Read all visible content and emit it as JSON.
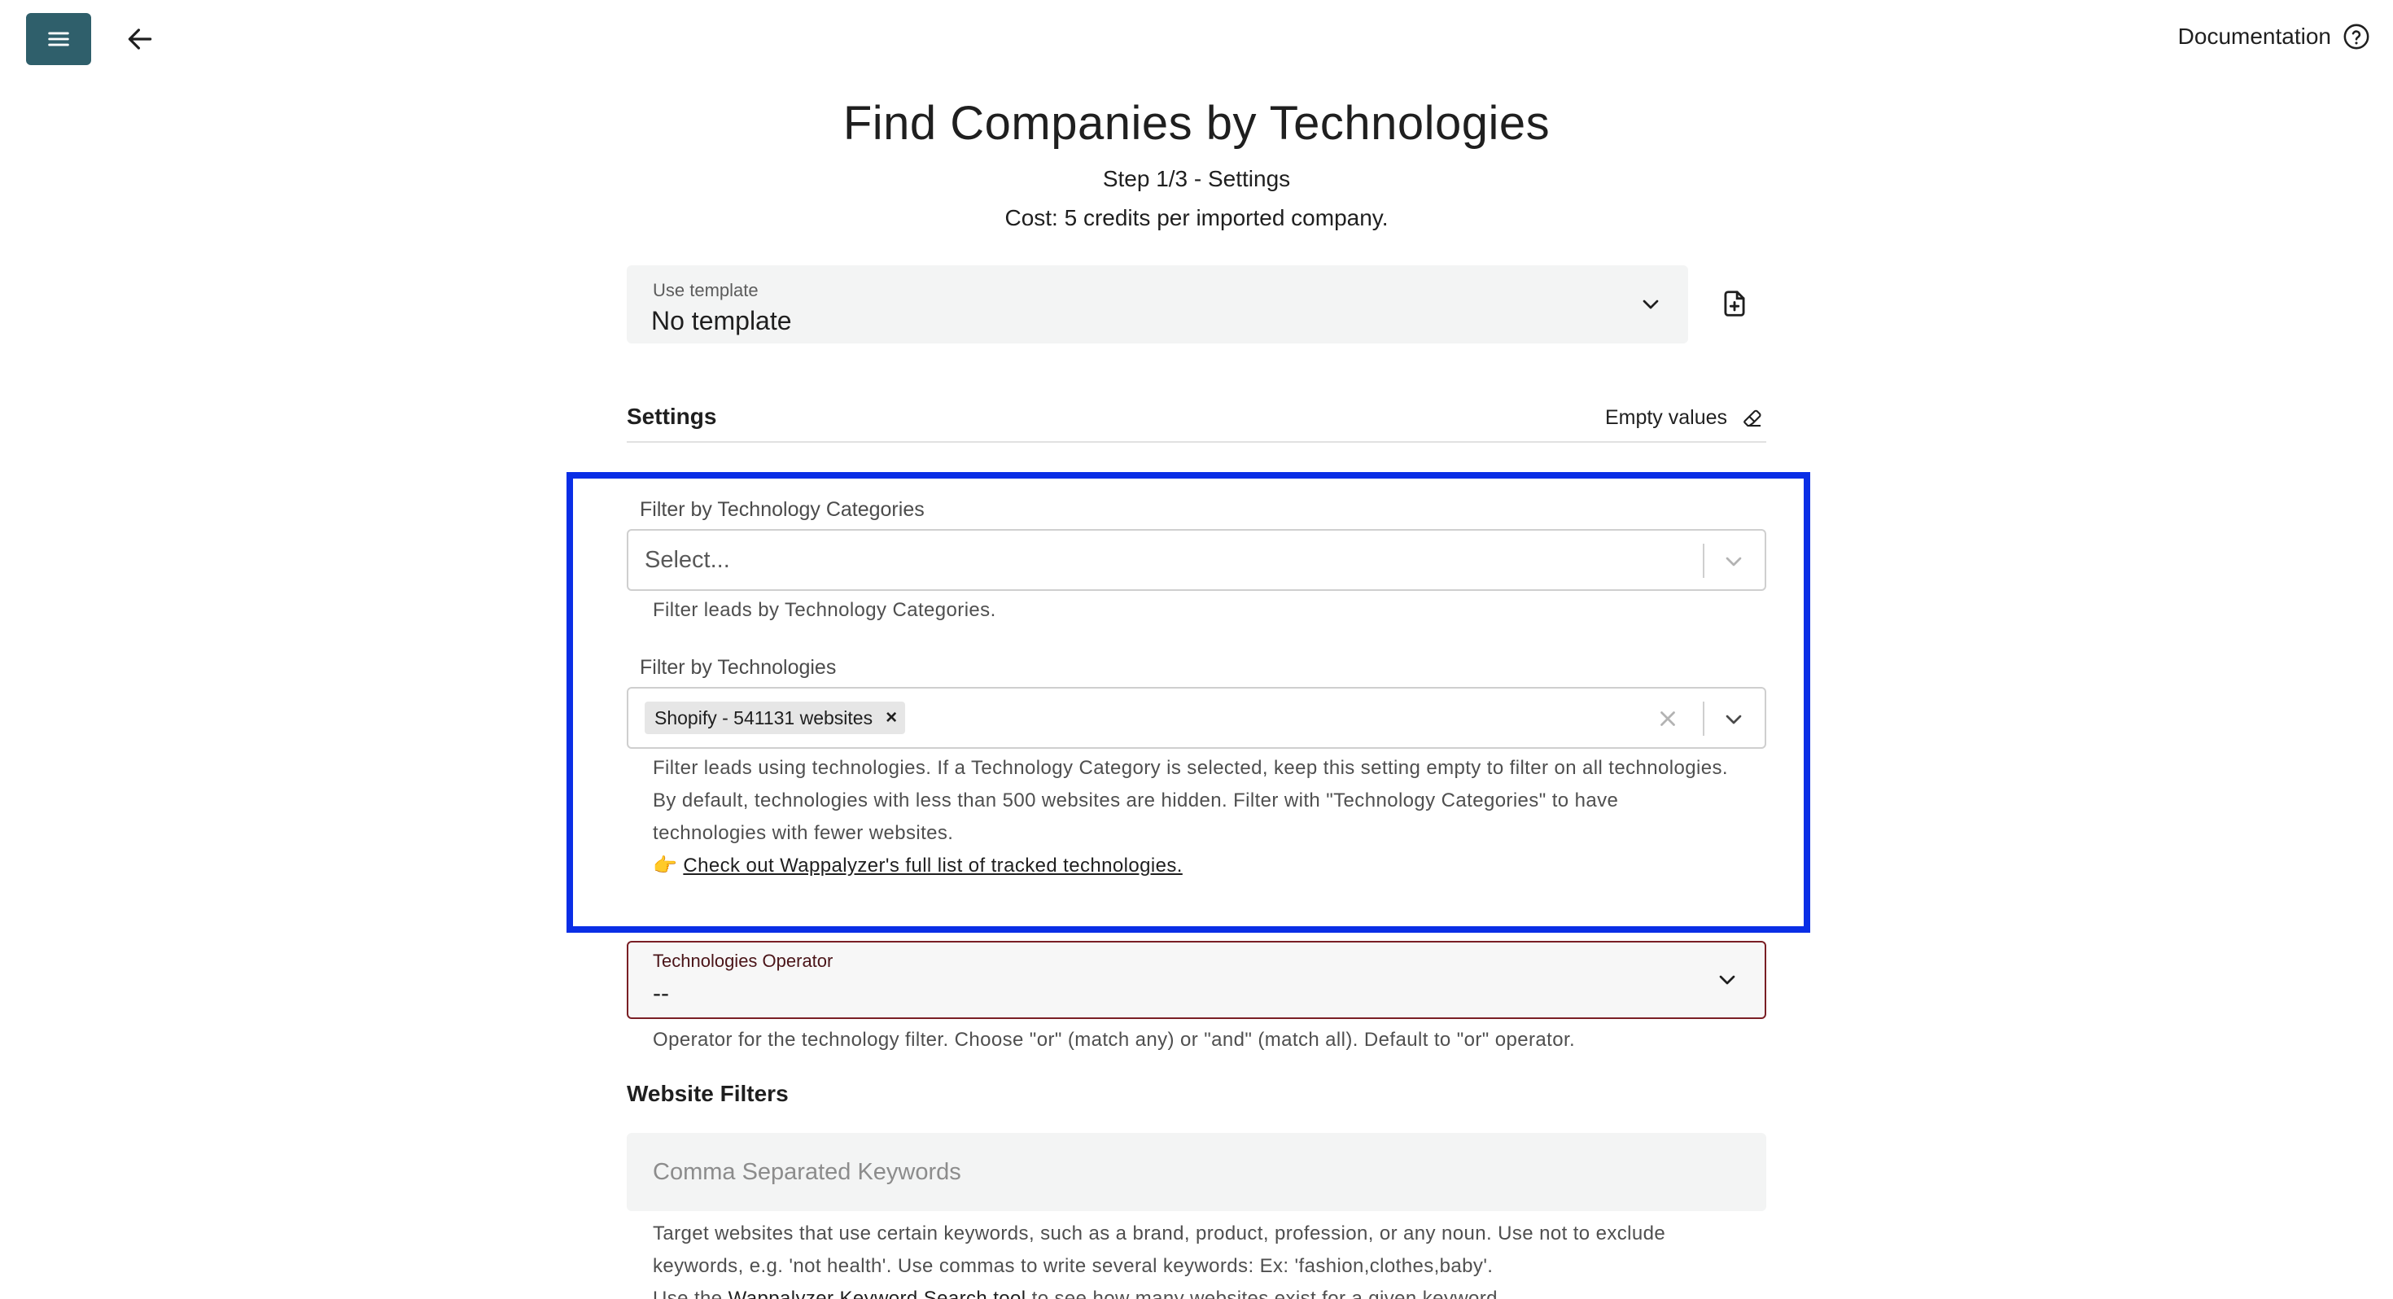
{
  "header": {
    "documentation_label": "Documentation",
    "icons": {
      "menu": "hamburger-menu-icon",
      "back": "arrow-left-icon",
      "help": "help-circle-icon"
    },
    "menu_button_color": "#2f5f6b"
  },
  "page": {
    "title": "Find Companies by Technologies",
    "step": "Step 1/3 - Settings",
    "cost": "Cost: 5 credits per imported company."
  },
  "template": {
    "label": "Use template",
    "value": "No template"
  },
  "settings": {
    "title": "Settings",
    "empty_values_label": "Empty values"
  },
  "tech_categories": {
    "label": "Filter by Technology Categories",
    "placeholder": "Select...",
    "help": "Filter leads by Technology Categories."
  },
  "technologies": {
    "label": "Filter by Technologies",
    "selected": [
      "Shopify - 541131 websites"
    ],
    "help_line1": "Filter leads using technologies. If a Technology Category is selected, keep this setting empty to filter on all technologies.",
    "help_line2": "By default, technologies with less than 500 websites are hidden. Filter with \"Technology Categories\" to have technologies with fewer websites.",
    "link_prefix": "👉",
    "link_text": "Check out Wappalyzer's full list of tracked technologies."
  },
  "operator": {
    "label": "Technologies Operator",
    "value": "--",
    "help": "Operator for the technology filter. Choose \"or\" (match any) or \"and\" (match all). Default to \"or\" operator."
  },
  "website_filters": {
    "title": "Website Filters",
    "keywords_placeholder": "Comma Separated Keywords",
    "help_line1": "Target websites that use certain keywords, such as a brand, product, profession, or any noun. Use not to exclude keywords, e.g. 'not health'. Use commas to write several keywords: Ex: 'fashion,clothes,baby'.",
    "help_line2_prefix": "Use the",
    "help_line2_link": "Wappalyzer Keyword Search tool",
    "help_line2_suffix": "to see how many websites exist for a given keyword."
  },
  "colors": {
    "highlight": "#0a2ee6",
    "operator_border": "#7a1f25"
  }
}
